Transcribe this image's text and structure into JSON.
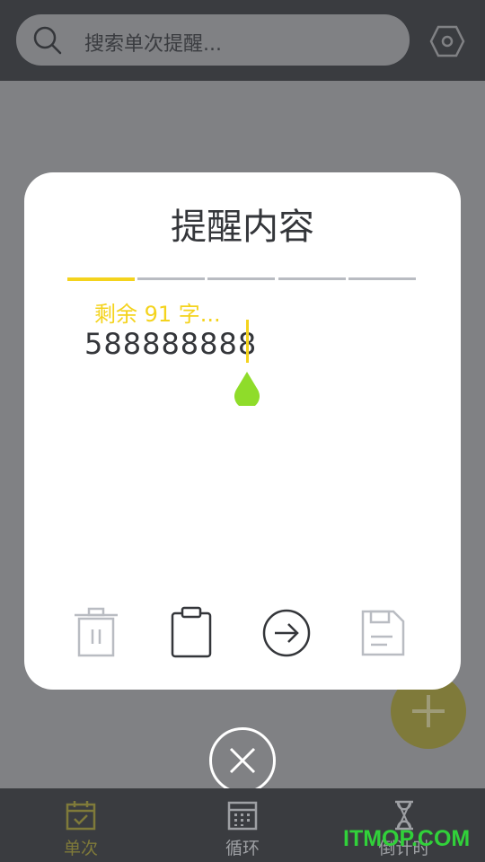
{
  "search": {
    "placeholder": "搜索单次提醒..."
  },
  "dialog": {
    "title": "提醒内容",
    "tabs": [
      "tab-1",
      "tab-2",
      "tab-3",
      "tab-4",
      "tab-5"
    ],
    "active_tab": 0,
    "remaining": "剩余 91 字...",
    "content": "588888888"
  },
  "actions": [
    "trash-icon",
    "clipboard-icon",
    "arrow-right-icon",
    "save-icon"
  ],
  "nav": {
    "items": [
      {
        "label": "单次",
        "icon": "calendar-check-icon",
        "active": true
      },
      {
        "label": "循环",
        "icon": "calendar-grid-icon",
        "active": false
      },
      {
        "label": "倒计时",
        "icon": "hourglass-icon",
        "active": false
      }
    ]
  },
  "watermark": "ITMOP.COM",
  "colors": {
    "accent": "#f4d31d",
    "handle": "#8fdc2a",
    "dark": "#3a3c40"
  }
}
